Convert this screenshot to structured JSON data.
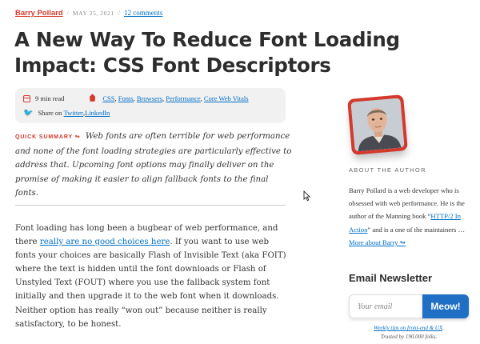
{
  "meta": {
    "author": "Barry Pollard",
    "separator": "/",
    "date": "May 25, 2021",
    "comments": "12 comments"
  },
  "article": {
    "title": "A New Way To Reduce Font Loading Impact: CSS Font Descriptors",
    "read_time": "9 min read",
    "tags": [
      "CSS",
      "Fonts",
      "Browsers",
      "Performance",
      "Core Web Vitals"
    ],
    "tag_sep": ", ",
    "share_prefix": "Share on",
    "share_links": [
      "Twitter",
      "LinkedIn"
    ],
    "summary_label": "Quick summary ↬",
    "summary": "Web fonts are often terrible for web performance and none of the font loading strategies are particularly effective to address that. Upcoming font options may finally deliver on the promise of making it easier to align fallback fonts to the final fonts.",
    "body_1": "Font loading has long been a bugbear of web performance, and there",
    "body_link": "really are no good choices here",
    "body_2": ". If you want to use web fonts your choices are basically Flash of Invisible Text (aka FOIT) where the text is hidden until the font downloads or Flash of Unstyled Text (FOUT) where you use the fallback system font initially and then upgrade it to the web font when it downloads. Neither option has really “won out” because neither is really satisfactory, to be honest."
  },
  "sidebar": {
    "about_heading": "About The Author",
    "about_1": "Barry Pollard is a web developer who is obsessed with web performance. He is the author of the Manning book “",
    "about_book": "HTTP/2 In Action",
    "about_2": "” and is a one of the maintainers … ",
    "about_more": "More about Barry ↬",
    "newsletter_title": "Email Newsletter",
    "email_placeholder": "Your email",
    "button_label": "Meow!",
    "note_link": "Weekly tips on front-end & UX",
    "note_dot": ".",
    "note_trusted": "Trusted by 190.000 folks."
  },
  "colors": {
    "accent": "#d33a2c",
    "link": "#006fc6",
    "button": "#1f6fc5"
  }
}
